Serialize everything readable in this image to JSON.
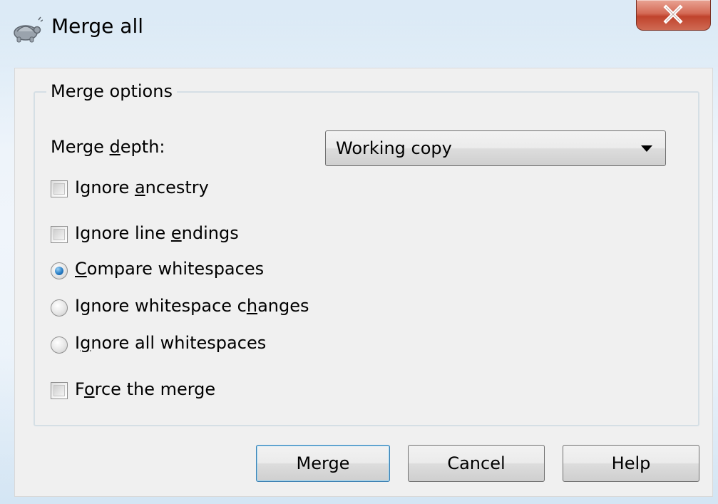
{
  "window": {
    "title": "Merge all",
    "close_symbol": "X",
    "app_icon": "tortoise-icon"
  },
  "options_group": {
    "legend": "Merge options",
    "merge_depth": {
      "label_pre": "Merge ",
      "label_u": "d",
      "label_post": "epth:",
      "value": "Working copy"
    },
    "ignore_ancestry": {
      "pre": "Ignore ",
      "u": "a",
      "post": "ncestry",
      "checked": false
    },
    "ignore_line_endings": {
      "pre": "Ignore line ",
      "u": "e",
      "post": "ndings",
      "checked": false
    },
    "whitespace": [
      {
        "pre": "",
        "u": "C",
        "post": "ompare whitespaces",
        "checked": true
      },
      {
        "pre": "Ignore whitespace c",
        "u": "h",
        "post": "anges",
        "checked": false
      },
      {
        "pre": "I",
        "u": "g",
        "post": "nore all whitespaces",
        "checked": false
      }
    ],
    "force_merge": {
      "pre": "F",
      "u": "o",
      "post": "rce the merge",
      "checked": false
    }
  },
  "buttons": {
    "merge": "Merge",
    "cancel": "Cancel",
    "help": "Help"
  }
}
